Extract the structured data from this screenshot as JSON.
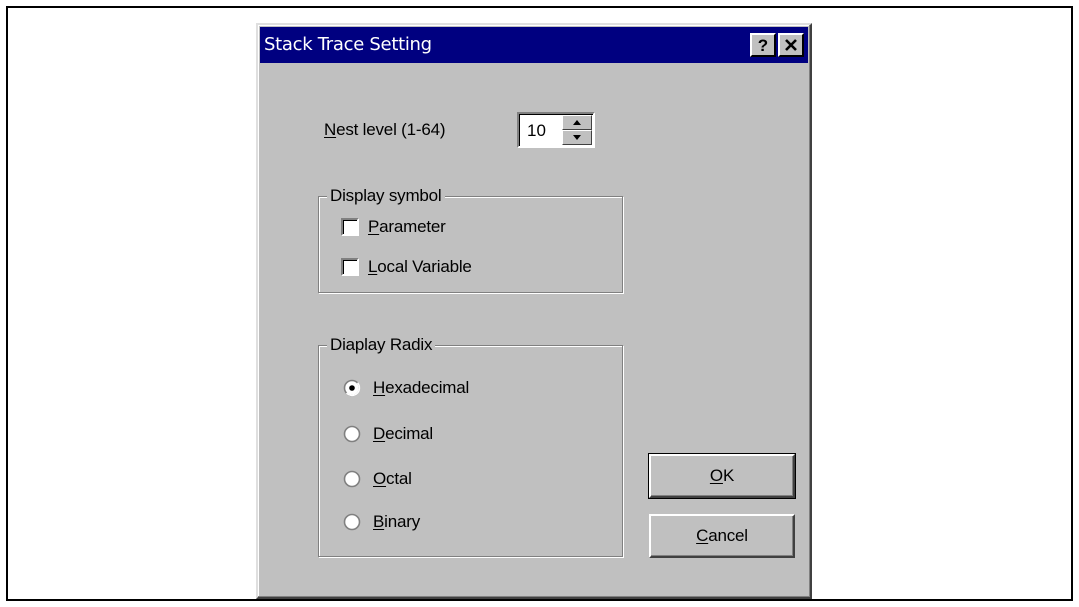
{
  "dialog": {
    "title": "Stack Trace Setting",
    "help_label": "?",
    "close_label": "×"
  },
  "nest_level": {
    "label_prefix": "",
    "mnemonic": "N",
    "label_rest": "est level (1-64)",
    "value": "10"
  },
  "display_symbol": {
    "title": "Display symbol",
    "options": [
      {
        "mnemonic": "P",
        "rest": "arameter",
        "checked": false
      },
      {
        "mnemonic": "L",
        "rest": "ocal Variable",
        "checked": false
      }
    ]
  },
  "display_radix": {
    "title": "Diaplay Radix",
    "options": [
      {
        "mnemonic": "H",
        "rest": "exadecimal",
        "selected": true
      },
      {
        "mnemonic": "D",
        "rest": "ecimal",
        "selected": false
      },
      {
        "mnemonic": "O",
        "rest": "ctal",
        "selected": false
      },
      {
        "mnemonic": "B",
        "rest": "inary",
        "selected": false
      }
    ]
  },
  "buttons": {
    "ok": {
      "mnemonic": "O",
      "rest": "K"
    },
    "cancel": {
      "mnemonic": "C",
      "rest": "ancel"
    }
  },
  "colors": {
    "titlebar": "#000080",
    "face": "#c0c0c0"
  }
}
